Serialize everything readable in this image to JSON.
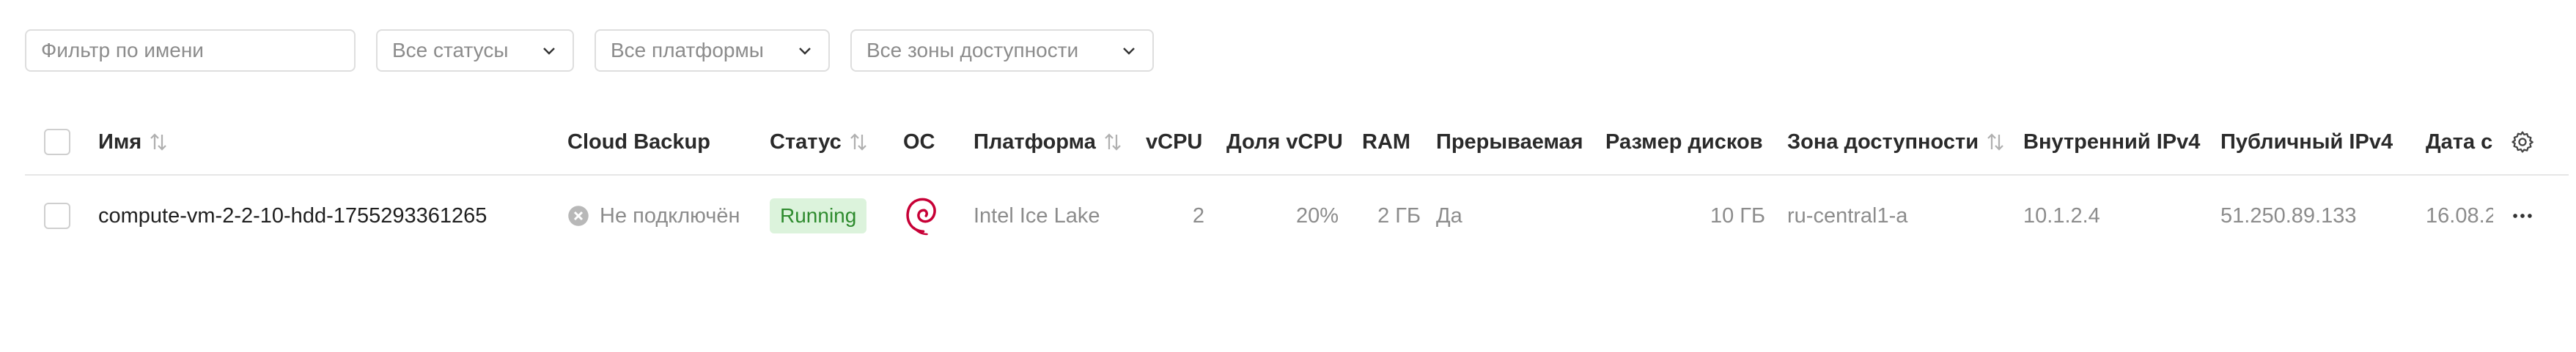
{
  "filters": {
    "name_placeholder": "Фильтр по имени",
    "status": "Все статусы",
    "platform": "Все платформы",
    "zone": "Все зоны доступности"
  },
  "columns": {
    "name": "Имя",
    "cloud_backup": "Cloud Backup",
    "status": "Статус",
    "os": "ОС",
    "platform": "Платформа",
    "vcpu": "vCPU",
    "vcpu_share": "Доля vCPU",
    "ram": "RAM",
    "preemptible": "Прерываемая",
    "disk_size": "Размер дисков",
    "zone": "Зона доступности",
    "internal_ipv4": "Внутренний IPv4",
    "public_ipv4": "Публичный IPv4",
    "date": "Дата с"
  },
  "rows": [
    {
      "name": "compute-vm-2-2-10-hdd-1755293361265",
      "cloud_backup": "Не подключён",
      "status": "Running",
      "os_icon": "debian-icon",
      "platform": "Intel Ice Lake",
      "vcpu": "2",
      "vcpu_share": "20%",
      "ram": "2 ГБ",
      "preemptible": "Да",
      "disk_size": "10 ГБ",
      "zone": "ru-central1-a",
      "internal_ipv4": "10.1.2.4",
      "public_ipv4": "51.250.89.133",
      "date": "16.08.2"
    }
  ],
  "colors": {
    "status_running_bg": "#dcf3dc",
    "status_running_text": "#2e8b2e",
    "debian_red": "#c70036"
  }
}
